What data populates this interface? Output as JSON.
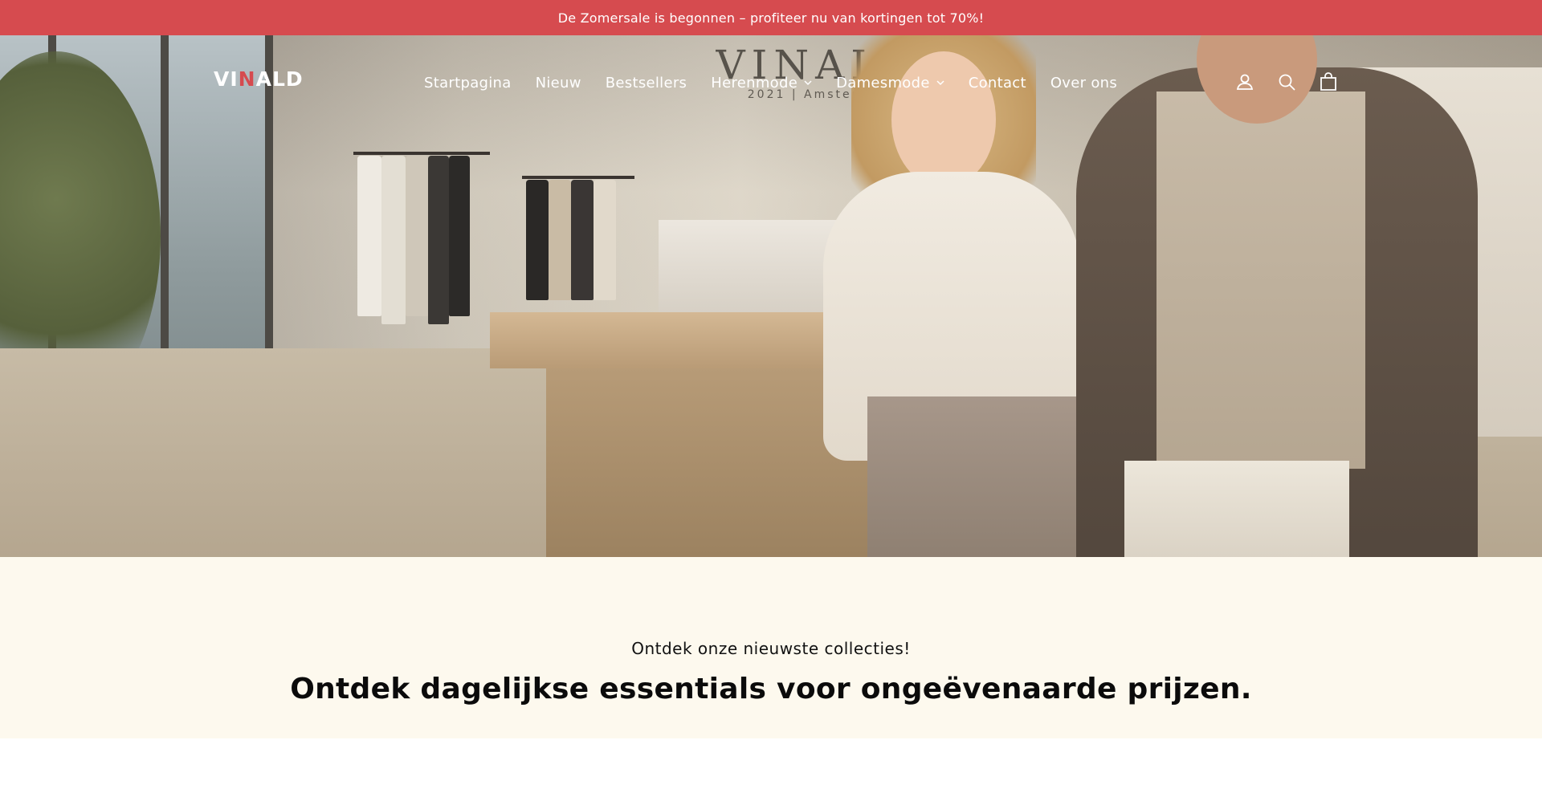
{
  "announcement": {
    "text": "De Zomersale is begonnen – profiteer nu van kortingen tot 70%!",
    "background_color": "#d64b4f"
  },
  "header": {
    "logo": {
      "prefix": "VI",
      "accent": "N",
      "suffix": "ALD"
    },
    "nav": [
      {
        "label": "Startpagina",
        "has_dropdown": false
      },
      {
        "label": "Nieuw",
        "has_dropdown": false
      },
      {
        "label": "Bestsellers",
        "has_dropdown": false
      },
      {
        "label": "Herenmode",
        "has_dropdown": true
      },
      {
        "label": "Damesmode",
        "has_dropdown": true
      },
      {
        "label": "Contact",
        "has_dropdown": false
      },
      {
        "label": "Over ons",
        "has_dropdown": false
      }
    ],
    "icons": [
      "account-icon",
      "search-icon",
      "cart-icon"
    ]
  },
  "hero": {
    "image": "store-interior-models-photo",
    "store_sign": {
      "name": "VINALD",
      "tagline": "2021 | Amsterdam"
    }
  },
  "intro": {
    "subtitle": "Ontdek onze nieuwste collecties!",
    "title": "Ontdek dagelijkse essentials voor ongeëvenaarde prijzen.",
    "background_color": "#fdf9ee"
  }
}
